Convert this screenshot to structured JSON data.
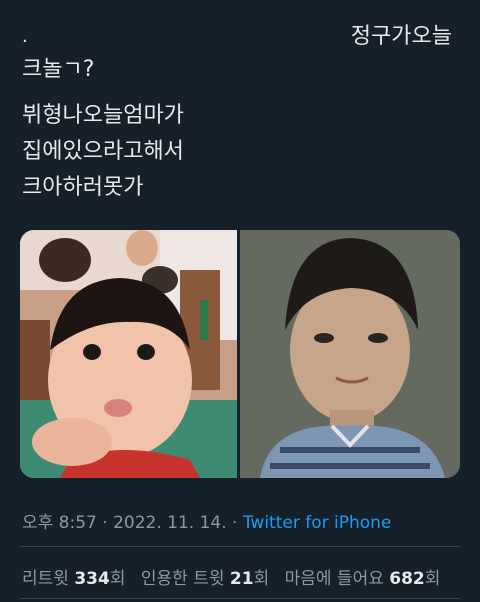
{
  "header": {
    "dot": ".",
    "reply_text": "정구가오늘"
  },
  "tweet": {
    "lines_1": [
      "크놀ㄱ?"
    ],
    "lines_2": [
      "뷔형나오늘엄마가",
      "집에있으라고해서",
      "크아하러못가"
    ]
  },
  "meta": {
    "time": "오후 8:57",
    "sep1": " · ",
    "date": "2022. 11. 14.",
    "sep2": " · ",
    "source": "Twitter for iPhone"
  },
  "stats": {
    "retweets_label": "리트윗 ",
    "retweets_value": "334",
    "retweets_unit": "회",
    "quotes_label": "인용한 트윗 ",
    "quotes_value": "21",
    "quotes_unit": "회",
    "likes_label": "마음에 들어요 ",
    "likes_value": "682",
    "likes_unit": "회"
  },
  "colors": {
    "background": "#15202b",
    "text": "#e7e9ea",
    "muted": "#8b98a5",
    "link": "#1d9bf0"
  }
}
